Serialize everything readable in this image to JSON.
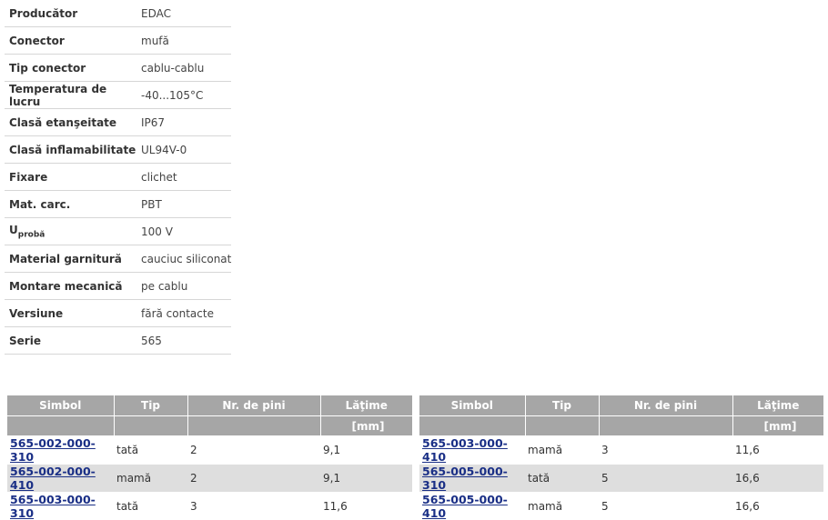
{
  "specs": [
    {
      "label": "Producător",
      "value": "EDAC"
    },
    {
      "label": "Conector",
      "value": "mufă"
    },
    {
      "label": "Tip conector",
      "value": "cablu-cablu"
    },
    {
      "label": "Temperatura de lucru",
      "value": "-40...105°C"
    },
    {
      "label": "Clasă etanşeitate",
      "value": "IP67"
    },
    {
      "label": "Clasă inflamabilitate",
      "value": "UL94V-0"
    },
    {
      "label": "Fixare",
      "value": "clichet"
    },
    {
      "label": "Mat. carc.",
      "value": "PBT"
    },
    {
      "label": "U",
      "label_sub": "probă",
      "value": "100 V"
    },
    {
      "label": "Material garnitură",
      "value": "cauciuc siliconat"
    },
    {
      "label": "Montare mecanică",
      "value": "pe cablu"
    },
    {
      "label": "Versiune",
      "value": "fără contacte"
    },
    {
      "label": "Serie",
      "value": "565"
    }
  ],
  "tables": {
    "headers": {
      "simbol": "Simbol",
      "tip": "Tip",
      "pini": "Nr. de pini",
      "latime": "Lăţime",
      "unit": "[mm]"
    },
    "left": [
      {
        "code": "565-002-000-310",
        "tip": "tată",
        "pini": "2",
        "latime": "9,1"
      },
      {
        "code": "565-002-000-410",
        "tip": "mamă",
        "pini": "2",
        "latime": "9,1"
      },
      {
        "code": "565-003-000-310",
        "tip": "tată",
        "pini": "3",
        "latime": "11,6"
      }
    ],
    "right": [
      {
        "code": "565-003-000-410",
        "tip": "mamă",
        "pini": "3",
        "latime": "11,6"
      },
      {
        "code": "565-005-000-310",
        "tip": "tată",
        "pini": "5",
        "latime": "16,6"
      },
      {
        "code": "565-005-000-410",
        "tip": "mamă",
        "pini": "5",
        "latime": "16,6"
      }
    ]
  }
}
